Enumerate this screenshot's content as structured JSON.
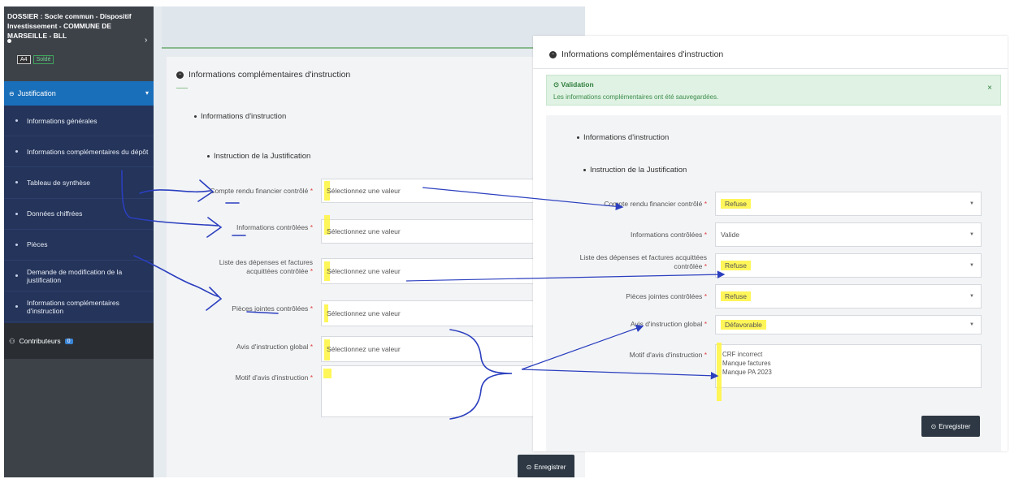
{
  "sidebar": {
    "dossier_title": "DOSSIER : Socle commun - Dispositif Investissement - COMMUNE DE MARSEILLE - BLL",
    "badge_code": "A4",
    "badge_status": "Soldé",
    "section_title": "Justification",
    "items": [
      {
        "label": "Informations générales"
      },
      {
        "label": "Informations complémentaires du dépôt"
      },
      {
        "label": "Tableau de synthèse"
      },
      {
        "label": "Données chiffrées"
      },
      {
        "label": "Pièces"
      },
      {
        "label": "Demande de modification de la justification"
      },
      {
        "label": "Informations complémentaires d'instruction"
      }
    ],
    "contributors_label": "Contributeurs",
    "contributors_count": "0"
  },
  "left_form": {
    "panel_title": "Informations complémentaires d'instruction",
    "section_1": "Informations d'instruction",
    "section_2": "Instruction de la Justification",
    "fields": [
      {
        "label": "Compte rendu financier contrôlé",
        "value": "Sélectionnez une valeur"
      },
      {
        "label": "Informations contrôlées",
        "value": "Sélectionnez une valeur"
      },
      {
        "label": "Liste des dépenses et factures acquittées contrôlée",
        "value": "Sélectionnez une valeur"
      },
      {
        "label": "Pièces jointes contrôlées",
        "value": "Sélectionnez une valeur"
      },
      {
        "label": "Avis d'instruction global",
        "value": "Sélectionnez une valeur"
      },
      {
        "label": "Motif d'avis d'instruction",
        "value": ""
      }
    ],
    "save_label": "Enregistrer",
    "required_mark": "*"
  },
  "right_form": {
    "panel_title": "Informations complémentaires d'instruction",
    "alert_title": "Validation",
    "alert_message": "Les informations complémentaires ont été sauvegardées.",
    "alert_close": "×",
    "section_1": "Informations d'instruction",
    "section_2": "Instruction de la Justification",
    "fields": [
      {
        "label": "Compte rendu financier contrôlé",
        "value": "Refuse"
      },
      {
        "label": "Informations contrôlées",
        "value": "Valide"
      },
      {
        "label": "Liste des dépenses et factures acquittées contrôlée",
        "value": "Refuse"
      },
      {
        "label": "Pièces jointes contrôlées",
        "value": "Refuse"
      },
      {
        "label": "Avis d'instruction global",
        "value": "Défavorable"
      },
      {
        "label": "Motif d'avis d'instruction",
        "value": "CRF incorrect\nManque factures\nManque PA 2023"
      }
    ],
    "save_label": "Enregistrer",
    "required_mark": "*"
  },
  "icons": {
    "collapse": "chevron-down-icon",
    "expand": "chevron-right-icon",
    "dropdown": "caret-down-icon",
    "close": "close-icon",
    "panel": "circle-minus-icon",
    "save": "save-icon",
    "validation": "check-circle-icon",
    "contributors": "users-icon"
  },
  "colors": {
    "sidebar_bg": "#3d4249",
    "nav_active": "#1a6fba",
    "nav_list": "#24345a",
    "highlight": "#fff53c",
    "annotation_blue": "#2b3fbf",
    "required": "#e03c3c",
    "validation_bg": "#dff2e3"
  }
}
